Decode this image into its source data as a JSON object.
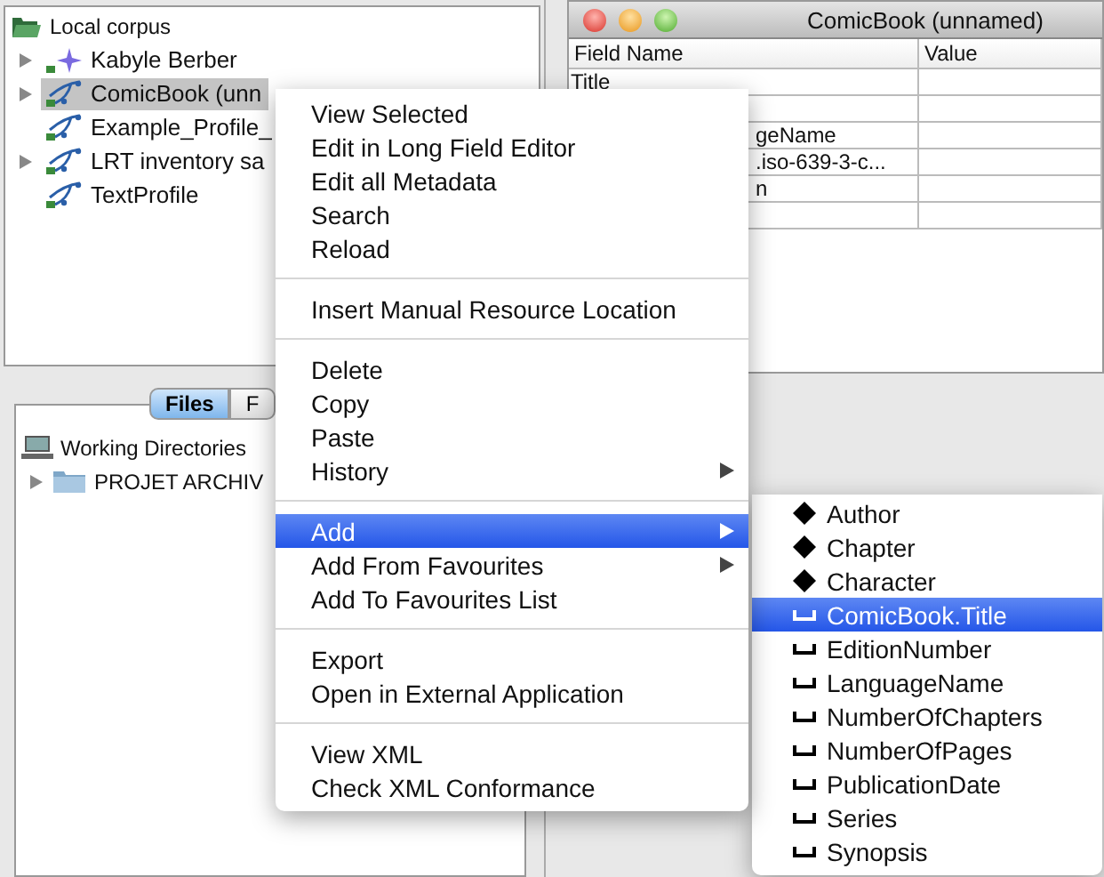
{
  "corpus_tree": {
    "root": "Local corpus",
    "items": [
      {
        "label": "Kabyle Berber",
        "kind": "corpus",
        "expandable": true,
        "selected": false
      },
      {
        "label": "ComicBook (unn",
        "kind": "profile",
        "expandable": true,
        "selected": true
      },
      {
        "label": "Example_Profile_",
        "kind": "profile",
        "expandable": false,
        "selected": false
      },
      {
        "label": "LRT inventory sa",
        "kind": "profile",
        "expandable": true,
        "selected": false
      },
      {
        "label": "TextProfile",
        "kind": "profile",
        "expandable": false,
        "selected": false
      }
    ]
  },
  "file_tabs": [
    {
      "label": "Files",
      "selected": true
    },
    {
      "label": "F",
      "selected": false
    }
  ],
  "file_tree": {
    "root": "Working Directories",
    "items": [
      {
        "label": "PROJET ARCHIV",
        "expandable": true
      }
    ]
  },
  "metadata_window": {
    "title": "ComicBook (unnamed)",
    "columns": [
      "Field Name",
      "Value"
    ],
    "rows": [
      {
        "field_name": "Title",
        "cut": false
      },
      {},
      {
        "field_name": "geName",
        "cut": true
      },
      {
        "field_name": ".iso-639-3-c...",
        "cut": true
      },
      {
        "field_name": "n",
        "cut": true
      },
      {}
    ]
  },
  "context_menu": {
    "items": [
      {
        "kind": "item",
        "label": "View Selected",
        "submenu": false,
        "selected": false
      },
      {
        "kind": "item",
        "label": "Edit in Long Field Editor",
        "submenu": false,
        "selected": false
      },
      {
        "kind": "item",
        "label": "Edit all Metadata",
        "submenu": false,
        "selected": false
      },
      {
        "kind": "item",
        "label": "Search",
        "submenu": false,
        "selected": false
      },
      {
        "kind": "item",
        "label": "Reload",
        "submenu": false,
        "selected": false
      },
      {
        "kind": "separator"
      },
      {
        "kind": "item",
        "label": "Insert Manual Resource Location",
        "submenu": false,
        "selected": false
      },
      {
        "kind": "separator"
      },
      {
        "kind": "item",
        "label": "Delete",
        "submenu": false,
        "selected": false
      },
      {
        "kind": "item",
        "label": "Copy",
        "submenu": false,
        "selected": false
      },
      {
        "kind": "item",
        "label": "Paste",
        "submenu": false,
        "selected": false
      },
      {
        "kind": "item",
        "label": "History",
        "submenu": true,
        "selected": false
      },
      {
        "kind": "separator"
      },
      {
        "kind": "item",
        "label": "Add",
        "submenu": true,
        "selected": true
      },
      {
        "kind": "item",
        "label": "Add From Favourites",
        "submenu": true,
        "selected": false
      },
      {
        "kind": "item",
        "label": "Add To Favourites List",
        "submenu": false,
        "selected": false
      },
      {
        "kind": "separator"
      },
      {
        "kind": "item",
        "label": "Export",
        "submenu": false,
        "selected": false
      },
      {
        "kind": "item",
        "label": "Open in External Application",
        "submenu": false,
        "selected": false
      },
      {
        "kind": "separator"
      },
      {
        "kind": "item",
        "label": "View XML",
        "submenu": false,
        "selected": false
      },
      {
        "kind": "item",
        "label": "Check XML Conformance",
        "submenu": false,
        "selected": false
      }
    ]
  },
  "add_submenu": {
    "items": [
      {
        "kind": "element",
        "label": "Author",
        "selected": false
      },
      {
        "kind": "element",
        "label": "Chapter",
        "selected": false
      },
      {
        "kind": "element",
        "label": "Character",
        "selected": false
      },
      {
        "kind": "field",
        "label": "ComicBook.Title",
        "selected": true
      },
      {
        "kind": "field",
        "label": "EditionNumber",
        "selected": false
      },
      {
        "kind": "field",
        "label": "LanguageName",
        "selected": false
      },
      {
        "kind": "field",
        "label": "NumberOfChapters",
        "selected": false
      },
      {
        "kind": "field",
        "label": "NumberOfPages",
        "selected": false
      },
      {
        "kind": "field",
        "label": "PublicationDate",
        "selected": false
      },
      {
        "kind": "field",
        "label": "Series",
        "selected": false
      },
      {
        "kind": "field",
        "label": "Synopsis",
        "selected": false
      }
    ]
  }
}
